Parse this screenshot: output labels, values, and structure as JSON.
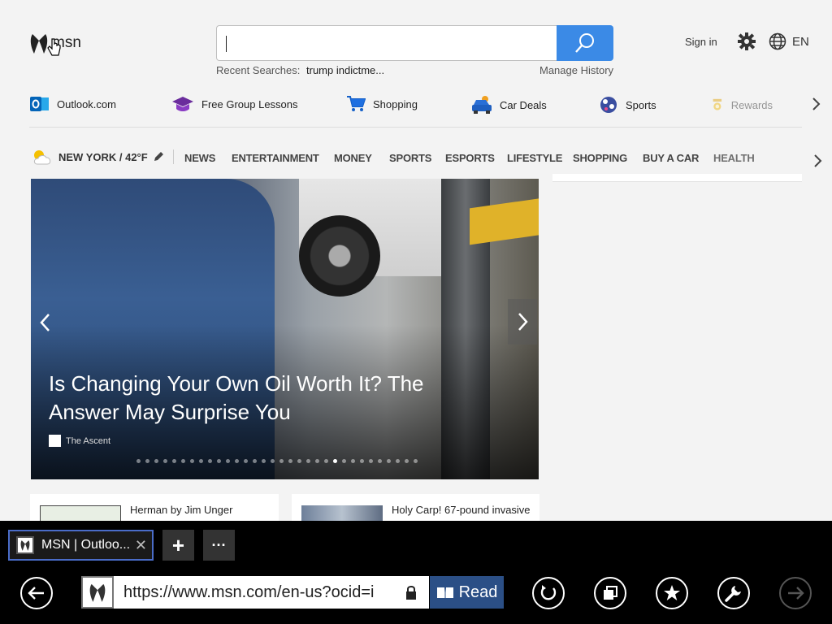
{
  "header": {
    "logo_text": "msn",
    "search": {
      "value": "",
      "placeholder": ""
    },
    "recent_label": "Recent Searches:",
    "recent_items": [
      "trump indictme..."
    ],
    "manage_history": "Manage History",
    "sign_in": "Sign in",
    "language": "EN"
  },
  "quick_links": [
    {
      "label": "Outlook.com"
    },
    {
      "label": "Free Group Lessons"
    },
    {
      "label": "Shopping"
    },
    {
      "label": "Car Deals"
    },
    {
      "label": "Sports"
    },
    {
      "label": "Rewards"
    }
  ],
  "nav": {
    "weather": "NEW YORK / 42°F",
    "items": [
      "NEWS",
      "ENTERTAINMENT",
      "MONEY",
      "SPORTS",
      "ESPORTS",
      "LIFESTYLE",
      "SHOPPING",
      "BUY A CAR",
      "HEALTH"
    ]
  },
  "hero": {
    "title": "Is Changing Your Own Oil Worth It? The Answer May Surprise You",
    "source": "The Ascent",
    "slide_count": 32,
    "active_slide": 22
  },
  "cards": [
    {
      "title": "Herman by Jim Unger"
    },
    {
      "title": "Holy Carp! 67-pound invasive"
    }
  ],
  "browser": {
    "tab_title": "MSN | Outloo...",
    "new_tab": "+",
    "more": "···",
    "url": "https://www.msn.com/en-us?ocid=i",
    "read_label": "Read"
  },
  "colors": {
    "accent": "#3b8ae6",
    "read_button": "#2b4f86",
    "tab_border": "#4a6cc8"
  }
}
